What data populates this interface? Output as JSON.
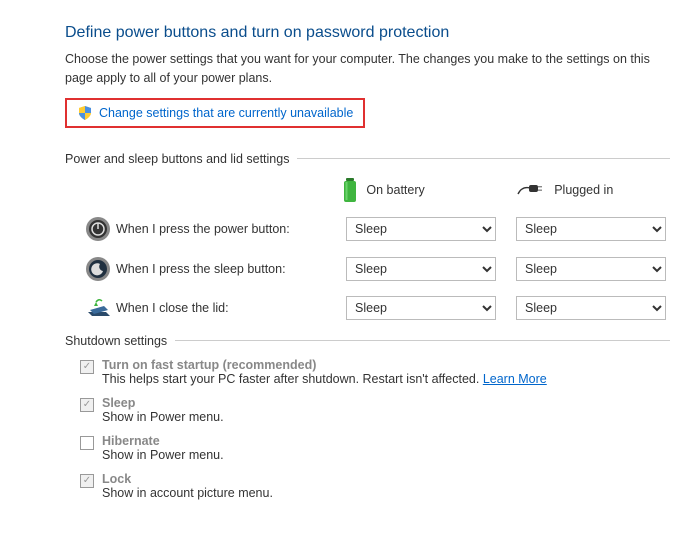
{
  "page": {
    "title": "Define power buttons and turn on password protection",
    "description": "Choose the power settings that you want for your computer. The changes you make to the settings on this page apply to all of your power plans.",
    "change_link": "Change settings that are currently unavailable"
  },
  "sections": {
    "power_sleep_header": "Power and sleep buttons and lid settings",
    "shutdown_header": "Shutdown settings"
  },
  "columns": {
    "battery": "On battery",
    "plugged": "Plugged in"
  },
  "rows": {
    "power_button": {
      "label": "When I press the power button:",
      "battery": "Sleep",
      "plugged": "Sleep"
    },
    "sleep_button": {
      "label": "When I press the sleep button:",
      "battery": "Sleep",
      "plugged": "Sleep"
    },
    "lid": {
      "label": "When I close the lid:",
      "battery": "Sleep",
      "plugged": "Sleep"
    }
  },
  "select_option": "Sleep",
  "shutdown": {
    "fast_startup": {
      "title": "Turn on fast startup (recommended)",
      "sub_prefix": "This helps start your PC faster after shutdown. Restart isn't affected. ",
      "learn": "Learn More"
    },
    "sleep": {
      "title": "Sleep",
      "sub": "Show in Power menu."
    },
    "hibernate": {
      "title": "Hibernate",
      "sub": "Show in Power menu."
    },
    "lock": {
      "title": "Lock",
      "sub": "Show in account picture menu."
    }
  }
}
